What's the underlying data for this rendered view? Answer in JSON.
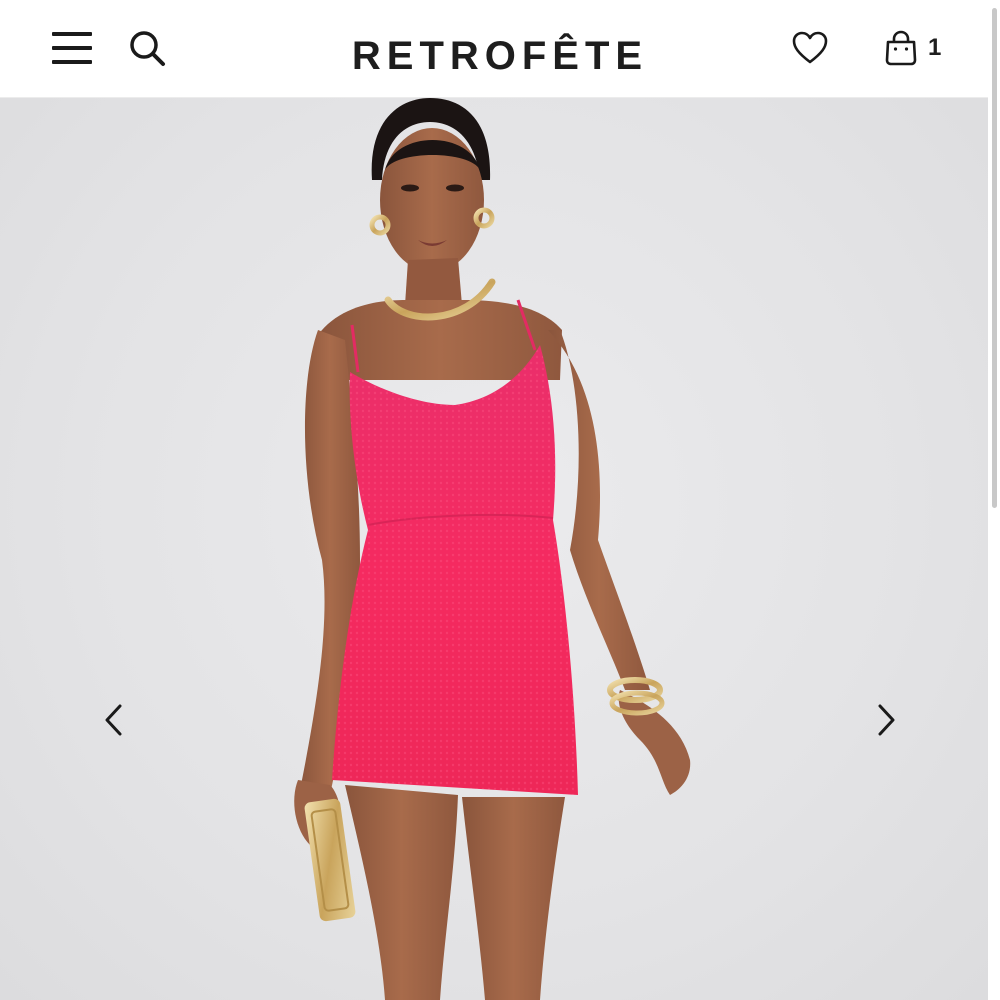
{
  "header": {
    "brand": "RETROFÊTE",
    "cart_count": "1"
  },
  "icons": {
    "menu": "hamburger-menu-icon",
    "search": "search-icon",
    "wishlist": "heart-icon",
    "cart": "shopping-bag-icon",
    "prev": "chevron-left-icon",
    "next": "chevron-right-icon"
  },
  "colors": {
    "dress": "#f02a63",
    "background": "#e4e4e6",
    "text": "#1e1e1e"
  }
}
